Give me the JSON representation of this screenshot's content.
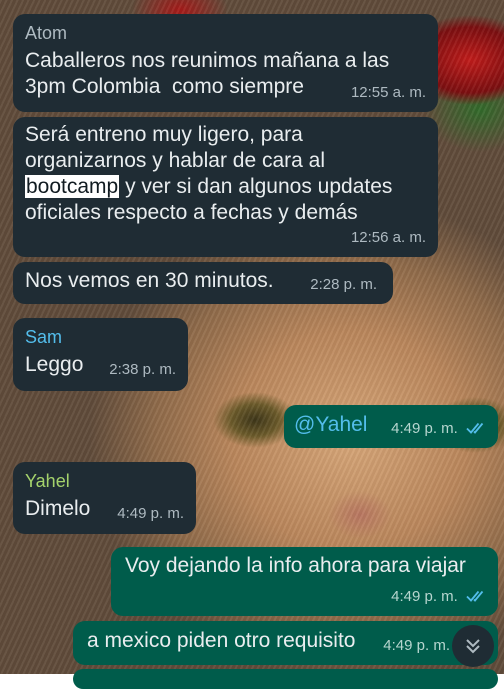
{
  "colors": {
    "incoming_bubble": "#1f2c34",
    "outgoing_bubble": "#005c4b",
    "text": "#e9edef",
    "timestamp": "#aebac1",
    "read_ticks": "#53bdeb",
    "sender_atom": "#aebac1",
    "sender_sam": "#53bdeb",
    "sender_yahel": "#a5d36c"
  },
  "messages": [
    {
      "sender": "Atom",
      "text": "Caballeros nos reunimos mañana a las\n3pm Colombia  como siempre",
      "time": "12:55 a. m."
    },
    {
      "text_before": "Será entreno muy ligero, para\norganizarnos y hablar de cara al\n",
      "highlight": "bootcamp",
      "text_after": " y ver si dan algunos updates\noficiales respecto a fechas y demás",
      "time": "12:56 a. m."
    },
    {
      "text": "Nos vemos en 30 minutos.",
      "time": "2:28 p. m."
    },
    {
      "sender": "Sam",
      "text": "Leggo",
      "time": "2:38 p. m."
    },
    {
      "text": "@Yahel",
      "time": "4:49 p. m.",
      "status_icon": "double-check-read"
    },
    {
      "sender": "Yahel",
      "text": "Dimelo",
      "time": "4:49 p. m."
    },
    {
      "text": "Voy dejando la info ahora para viajar",
      "time": "4:49 p. m.",
      "status_icon": "double-check-read"
    },
    {
      "text": "a mexico piden otro requisito",
      "time": "4:49 p. m."
    }
  ],
  "scroll_button_icon": "double-chevron-down-icon"
}
